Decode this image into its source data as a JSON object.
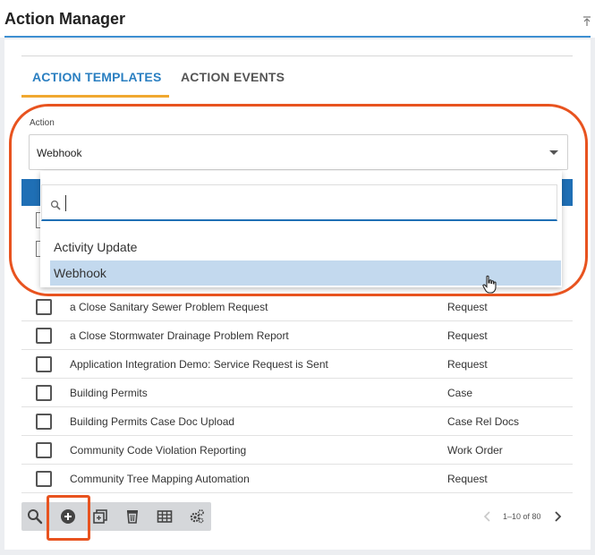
{
  "app": {
    "title": "Action Manager"
  },
  "tabs": [
    {
      "label": "ACTION TEMPLATES",
      "active": true
    },
    {
      "label": "ACTION EVENTS",
      "active": false
    }
  ],
  "action_field": {
    "label": "Action",
    "value": "Webhook"
  },
  "dropdown": {
    "search_value": "",
    "options": [
      {
        "label": "Activity Update",
        "selected": false
      },
      {
        "label": "Webhook",
        "selected": true
      }
    ]
  },
  "rows": [
    {
      "name": "a Close Sanitary Sewer Problem Request",
      "type": "Request"
    },
    {
      "name": "a Close Stormwater Drainage Problem Report",
      "type": "Request"
    },
    {
      "name": "Application Integration Demo: Service Request is Sent",
      "type": "Request"
    },
    {
      "name": "Building Permits",
      "type": "Case"
    },
    {
      "name": "Building Permits Case Doc Upload",
      "type": "Case Rel Docs"
    },
    {
      "name": "Community Code Violation Reporting",
      "type": "Work Order"
    },
    {
      "name": "Community Tree Mapping Automation",
      "type": "Request"
    }
  ],
  "toolbar": {
    "icons": [
      "search-icon",
      "add-circle-icon",
      "copy-icon",
      "trash-icon",
      "table-icon",
      "settings-icon"
    ]
  },
  "pagination": {
    "text": "1–10 of 80"
  },
  "colors": {
    "accent_blue": "#1f6fb5",
    "tab_underline": "#f0a830",
    "annotation": "#e8531f",
    "selected_option": "#c3d9ee"
  }
}
